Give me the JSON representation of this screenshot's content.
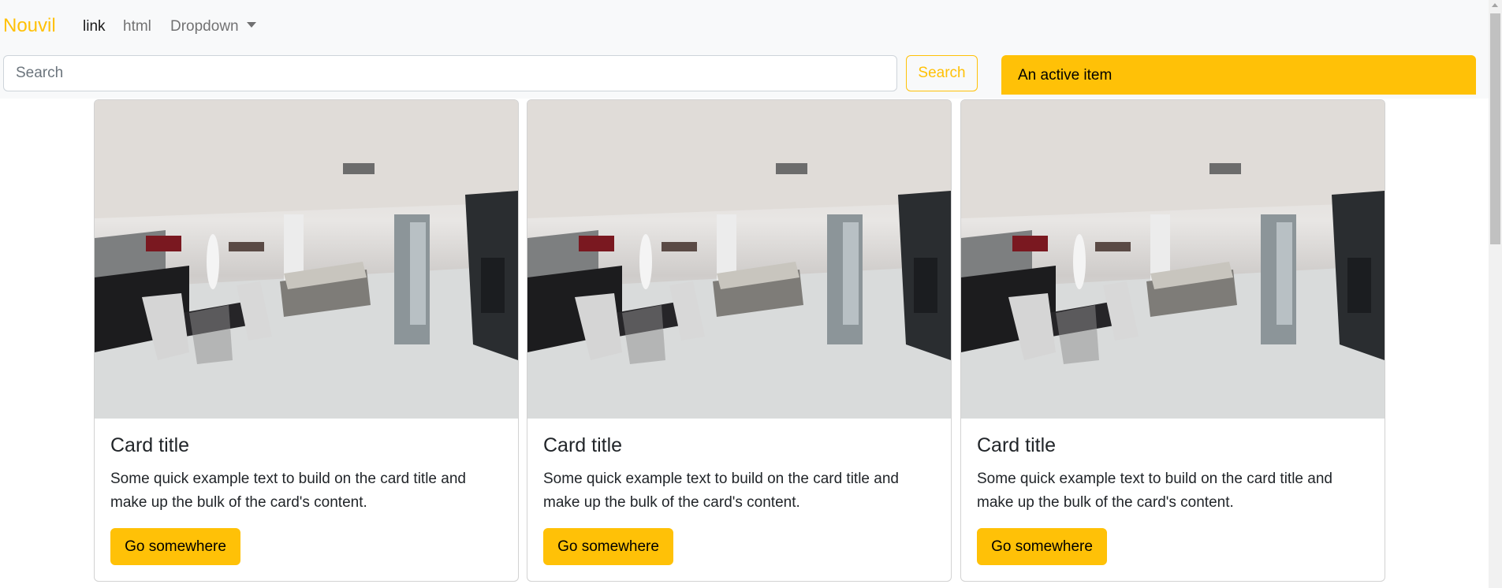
{
  "navbar": {
    "brand": "Nouvil",
    "links": [
      {
        "label": "link",
        "active": true
      },
      {
        "label": "html",
        "active": false
      },
      {
        "label": "Dropdown",
        "active": false
      }
    ],
    "search": {
      "placeholder": "Search",
      "value": "",
      "button_label": "Search"
    },
    "list_item": "An active item"
  },
  "cards": [
    {
      "image_alt": "Living room interior with dining table and zebra-print chairs",
      "title": "Card title",
      "text": "Some quick example text to build on the card title and make up the bulk of the card's content.",
      "button_label": "Go somewhere"
    },
    {
      "image_alt": "Living room interior with dining table and zebra-print chairs",
      "title": "Card title",
      "text": "Some quick example text to build on the card title and make up the bulk of the card's content.",
      "button_label": "Go somewhere"
    },
    {
      "image_alt": "Living room interior with dining table and zebra-print chairs",
      "title": "Card title",
      "text": "Some quick example text to build on the card title and make up the bulk of the card's content.",
      "button_label": "Go somewhere"
    }
  ],
  "colors": {
    "accent": "#ffc107",
    "navbar_bg": "#f8f9fa",
    "text": "#212529"
  }
}
